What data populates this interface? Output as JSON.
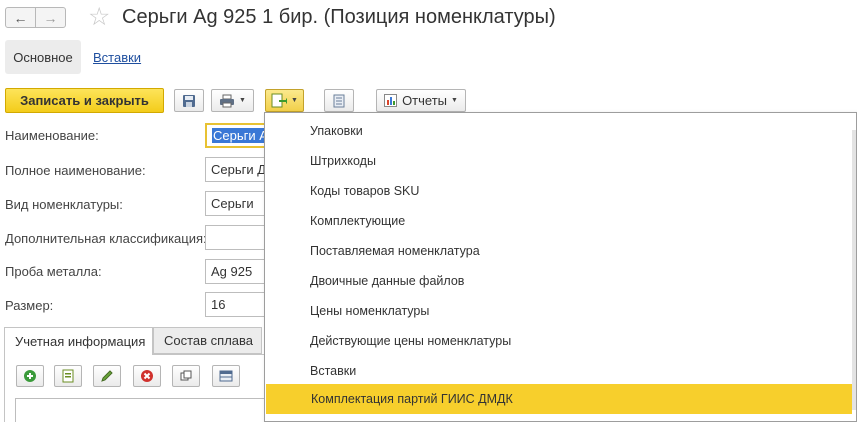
{
  "window": {
    "title": "Серьги Ag 925 1 бир. (Позиция номенклатуры)",
    "back_glyph": "←",
    "forward_glyph": "→",
    "star_glyph": "☆"
  },
  "sections": {
    "main": "Основное",
    "inserts": "Вставки"
  },
  "toolbar": {
    "save_close": "Записать и закрыть",
    "reports": "Отчеты",
    "caret": "▼"
  },
  "form": {
    "name_label": "Наименование:",
    "name_value": "Серьги A",
    "full_name_label": "Полное наименование:",
    "full_name_value": "Серьги Д",
    "kind_label": "Вид номенклатуры:",
    "kind_value": "Серьги",
    "extra_class_label": "Дополнительная классификация:",
    "extra_class_value": "",
    "metal_label": "Проба металла:",
    "metal_value": "Ag 925",
    "size_label": "Размер:",
    "size_value": "16"
  },
  "tabs": {
    "accounting": "Учетная информация",
    "alloy": "Состав сплава"
  },
  "menu": {
    "items": [
      "Упаковки",
      "Штрихкоды",
      "Коды товаров SKU",
      "Комплектующие",
      "Поставляемая номенклатура",
      "Двоичные данные файлов",
      "Цены номенклатуры",
      "Действующие цены номенклатуры",
      "Вставки",
      "Комплектация партий ГИИС ДМДК"
    ],
    "highlighted_index": 9
  },
  "colors": {
    "accent_yellow": "#f7cf2c",
    "link_blue": "#1f4f9f",
    "selection_blue": "#3a78d6"
  }
}
